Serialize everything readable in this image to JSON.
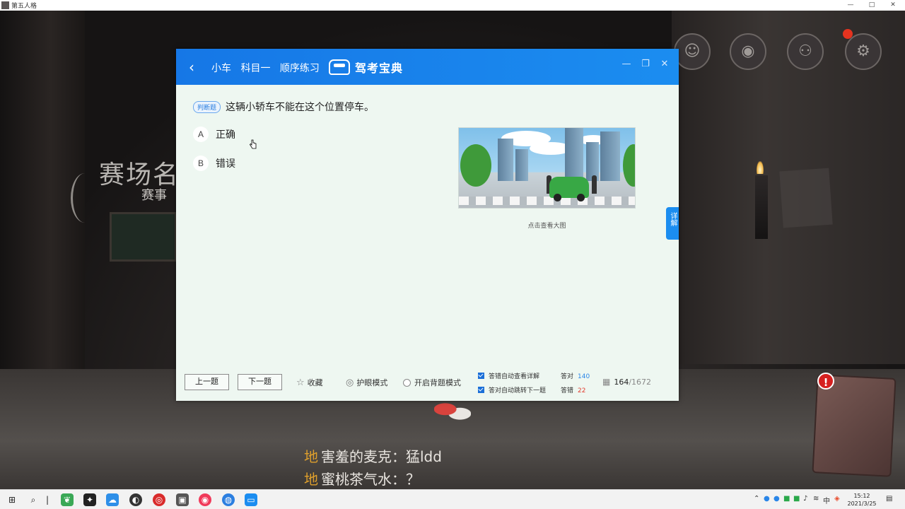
{
  "game": {
    "window_title": "第五人格",
    "arena_title": "赛场名",
    "arena_subtitle": "赛事",
    "chat": [
      {
        "tag": "地",
        "text": "害羞的麦克：猛ldd"
      },
      {
        "tag": "地",
        "text": "蜜桃茶气水：？"
      }
    ],
    "book_alert": "!"
  },
  "app": {
    "breadcrumbs": [
      "小车",
      "科目一",
      "顺序练习"
    ],
    "brand_name": "驾考宝典",
    "question": {
      "type_tag": "判断题",
      "text": "这辆小轿车不能在这个位置停车。",
      "options": [
        {
          "letter": "A",
          "text": "正确"
        },
        {
          "letter": "B",
          "text": "错误"
        }
      ],
      "image_caption": "点击查看大图"
    },
    "side_tab": "详解",
    "footer": {
      "prev": "上一题",
      "next": "下一题",
      "favorite": "收藏",
      "eye_mode": "护眼模式",
      "recite_mode": "开启背题模式",
      "auto_show_explain": "答错自动查看详解",
      "auto_next": "答对自动跳转下一题",
      "right_label": "答对",
      "right_count": "140",
      "wrong_label": "答错",
      "wrong_count": "22",
      "current": "164",
      "total": "/1672"
    }
  },
  "taskbar": {
    "time": "15:12",
    "date": "2021/3/25"
  },
  "colors": {
    "header_blue": "#1677e6",
    "right_blue": "#2a86e8",
    "wrong_red": "#e23b2e"
  }
}
